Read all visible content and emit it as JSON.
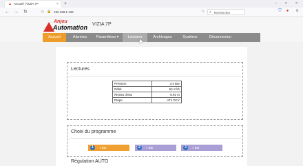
{
  "browser": {
    "tab_title": "Accueil | VIZIA 7P",
    "new_tab": "+",
    "tab_close": "×",
    "url": "192.168.1.126",
    "search_placeholder": "Rechercher",
    "window_controls": [
      "–",
      "□",
      "×"
    ]
  },
  "site": {
    "logo_line1": "Anjou",
    "logo_line2": "Automation",
    "title": "VIZIA 7P",
    "nav": [
      {
        "label": "Accueil"
      },
      {
        "label": "Alarmes"
      },
      {
        "label": "Paramètres ▾"
      },
      {
        "label": "Lectures"
      },
      {
        "label": "Archivages"
      },
      {
        "label": "Système"
      },
      {
        "label": "Déconnexion"
      }
    ],
    "active_nav": "Accueil",
    "hover_nav": "Lectures"
  },
  "lectures": {
    "title": "Lectures",
    "rows": [
      {
        "label": "Pression",
        "value": "3.4 Bar"
      },
      {
        "label": "Débit",
        "value": "54 m³/h"
      },
      {
        "label": "Niveau d'eau",
        "value": "8.92 m"
      },
      {
        "label": "Etape",
        "value": "AT1 DCY"
      }
    ]
  },
  "programme": {
    "title": "Choix du programme",
    "options": [
      {
        "num": "1",
        "label": "7 Bar",
        "selected": true
      },
      {
        "num": "2",
        "label": "7 Bar",
        "selected": false
      },
      {
        "num": "3",
        "label": "7 Bar",
        "selected": false
      }
    ]
  },
  "regulation": {
    "title": "Régulation AUTO"
  },
  "colors": {
    "nav_bg": "#8b8b8b",
    "nav_active": "#ee9c2a",
    "prog_selected": "#f0a030",
    "prog_other": "#a99ed6",
    "brand_red": "#d6322a"
  }
}
